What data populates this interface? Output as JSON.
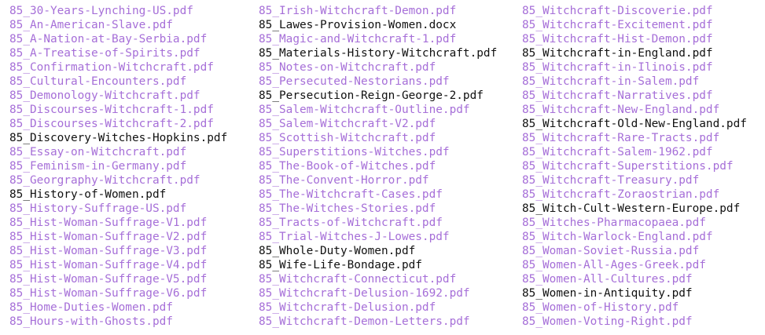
{
  "colors": {
    "link": "#a66fd8",
    "plain": "#111111",
    "background": "#ffffff"
  },
  "columns": [
    {
      "items": [
        {
          "name": "85_30-Years-Lynching-US.pdf",
          "link": true
        },
        {
          "name": "85_An-American-Slave.pdf",
          "link": true
        },
        {
          "name": "85_A-Nation-at-Bay-Serbia.pdf",
          "link": true
        },
        {
          "name": "85_A-Treatise-of-Spirits.pdf",
          "link": true
        },
        {
          "name": "85_Confirmation-Witchcraft.pdf",
          "link": true
        },
        {
          "name": "85_Cultural-Encounters.pdf",
          "link": true
        },
        {
          "name": "85_Demonology-Witchcraft.pdf",
          "link": true
        },
        {
          "name": "85_Discourses-Witchcraft-1.pdf",
          "link": true
        },
        {
          "name": "85_Discourses-Witchcraft-2.pdf",
          "link": true
        },
        {
          "name": "85_Discovery-Witches-Hopkins.pdf",
          "link": false
        },
        {
          "name": "85_Essay-on-Witchcraft.pdf",
          "link": true
        },
        {
          "name": "85_Feminism-in-Germany.pdf",
          "link": true
        },
        {
          "name": "85_Georgraphy-Witchcraft.pdf",
          "link": true
        },
        {
          "name": "85_History-of-Women.pdf",
          "link": false
        },
        {
          "name": "85_History-Suffrage-US.pdf",
          "link": true
        },
        {
          "name": "85_Hist-Woman-Suffrage-V1.pdf",
          "link": true
        },
        {
          "name": "85_Hist-Woman-Suffrage-V2.pdf",
          "link": true
        },
        {
          "name": "85_Hist-Woman-Suffrage-V3.pdf",
          "link": true
        },
        {
          "name": "85_Hist-Woman-Suffrage-V4.pdf",
          "link": true
        },
        {
          "name": "85_Hist-Woman-Suffrage-V5.pdf",
          "link": true
        },
        {
          "name": "85_Hist-Woman-Suffrage-V6.pdf",
          "link": true
        },
        {
          "name": "85_Home-Duties-Women.pdf",
          "link": true
        },
        {
          "name": "85_Hours-with-Ghosts.pdf",
          "link": true
        }
      ]
    },
    {
      "items": [
        {
          "name": "85_Irish-Witchcraft-Demon.pdf",
          "link": true
        },
        {
          "name": "85_Lawes-Provision-Women.docx",
          "link": false
        },
        {
          "name": "85_Magic-and-Witchcraft-1.pdf",
          "link": true
        },
        {
          "name": "85_Materials-History-Witchcraft.pdf",
          "link": false
        },
        {
          "name": "85_Notes-on-Witchcraft.pdf",
          "link": true
        },
        {
          "name": "85_Persecuted-Nestorians.pdf",
          "link": true
        },
        {
          "name": "85_Persecution-Reign-George-2.pdf",
          "link": false
        },
        {
          "name": "85_Salem-Witchcraft-Outline.pdf",
          "link": true
        },
        {
          "name": "85_Salem-Witchcraft-V2.pdf",
          "link": true
        },
        {
          "name": "85_Scottish-Witchcraft.pdf",
          "link": true
        },
        {
          "name": "85_Superstitions-Witches.pdf",
          "link": true
        },
        {
          "name": "85_The-Book-of-Witches.pdf",
          "link": true
        },
        {
          "name": "85_The-Convent-Horror.pdf",
          "link": true
        },
        {
          "name": "85_The-Witchcraft-Cases.pdf",
          "link": true
        },
        {
          "name": "85_The-Witches-Stories.pdf",
          "link": true
        },
        {
          "name": "85_Tracts-of-Witchcraft.pdf",
          "link": true
        },
        {
          "name": "85_Trial-Witches-J-Lowes.pdf",
          "link": true
        },
        {
          "name": "85_Whole-Duty-Women.pdf",
          "link": false
        },
        {
          "name": "85_Wife-Life-Bondage.pdf",
          "link": false
        },
        {
          "name": "85_Witchcraft-Connecticut.pdf",
          "link": true
        },
        {
          "name": "85_Witchcraft-Delusion-1692.pdf",
          "link": true
        },
        {
          "name": "85_Witchcraft-Delusion.pdf",
          "link": true
        },
        {
          "name": "85_Witchcraft-Demon-Letters.pdf",
          "link": true
        }
      ]
    },
    {
      "items": [
        {
          "name": "85_Witchcraft-Discoverie.pdf",
          "link": true
        },
        {
          "name": "85_Witchcraft-Excitement.pdf",
          "link": true
        },
        {
          "name": "85_Witchcraft-Hist-Demon.pdf",
          "link": true
        },
        {
          "name": "85_Witchcraft-in-England.pdf",
          "link": false
        },
        {
          "name": "85_Witchcraft-in-Ilinois.pdf",
          "link": true
        },
        {
          "name": "85_Witchcraft-in-Salem.pdf",
          "link": true
        },
        {
          "name": "85_Witchcraft-Narratives.pdf",
          "link": true
        },
        {
          "name": "85_Witchcraft-New-England.pdf",
          "link": true
        },
        {
          "name": "85_Witchcraft-Old-New-England.pdf",
          "link": false
        },
        {
          "name": "85_Witchcraft-Rare-Tracts.pdf",
          "link": true
        },
        {
          "name": "85_Witchcraft-Salem-1962.pdf",
          "link": true
        },
        {
          "name": "85_Witchcraft-Superstitions.pdf",
          "link": true
        },
        {
          "name": "85_Witchcraft-Treasury.pdf",
          "link": true
        },
        {
          "name": "85_Witchcraft-Zoraostrian.pdf",
          "link": true
        },
        {
          "name": "85_Witch-Cult-Western-Europe.pdf",
          "link": false
        },
        {
          "name": "85_Witches-Pharmacopaea.pdf",
          "link": true
        },
        {
          "name": "85_Witch-Warlock-England.pdf",
          "link": true
        },
        {
          "name": "85_Woman-Soviet-Russia.pdf",
          "link": true
        },
        {
          "name": "85_Women-All-Ages-Greek.pdf",
          "link": true
        },
        {
          "name": "85_Women-All-Cultures.pdf",
          "link": true
        },
        {
          "name": "85_Women-in-Antiquity.pdf",
          "link": false
        },
        {
          "name": "85_Women-of-History.pdf",
          "link": true
        },
        {
          "name": "85_Women-Voting-Right.pdf",
          "link": true
        }
      ]
    }
  ]
}
